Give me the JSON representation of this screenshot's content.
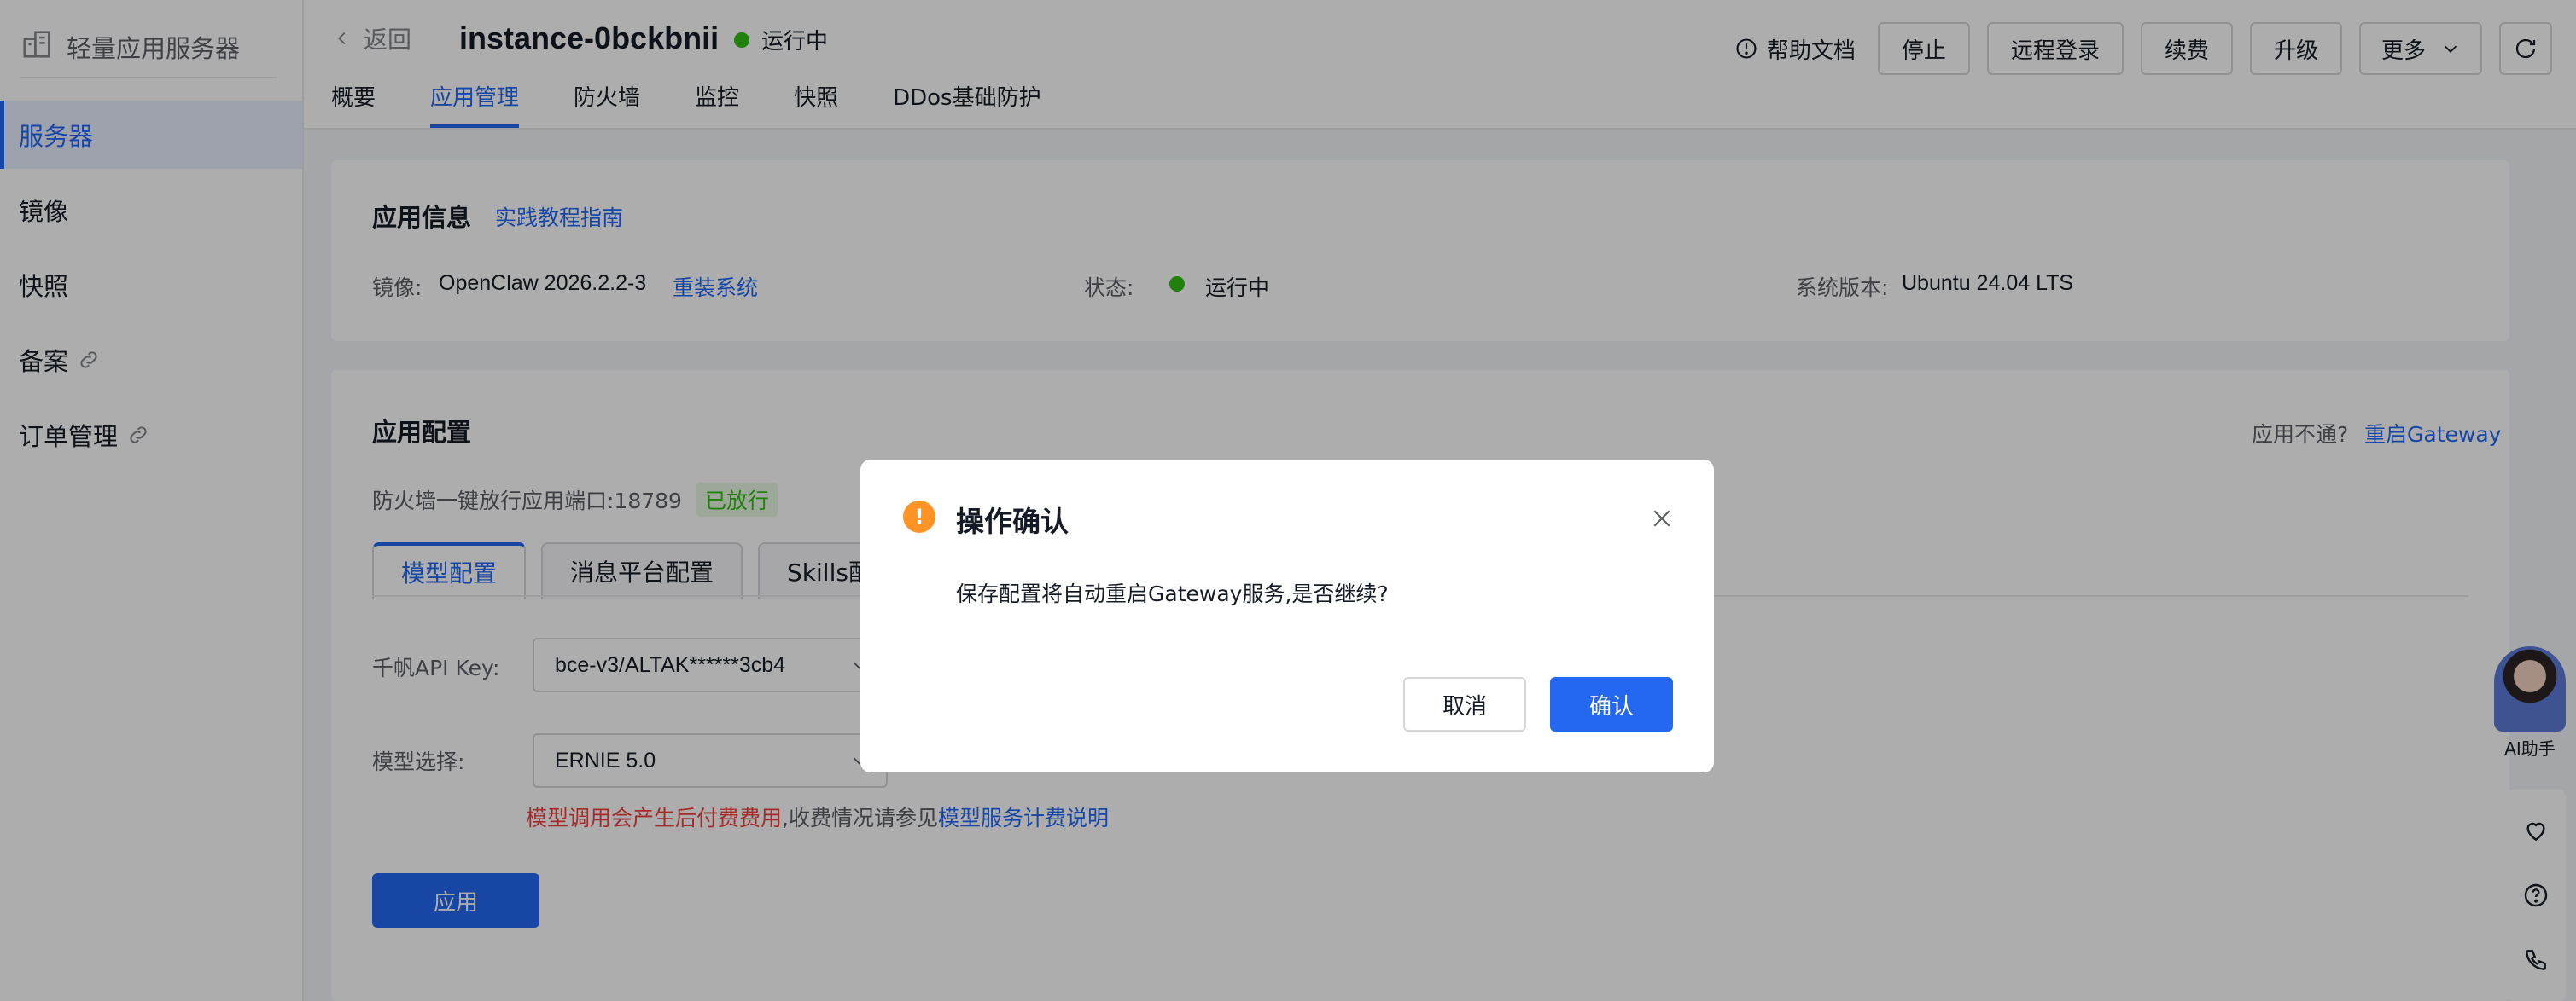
{
  "sidebar": {
    "title": "轻量应用服务器",
    "items": [
      {
        "label": "服务器",
        "active": true
      },
      {
        "label": "镜像"
      },
      {
        "label": "快照"
      },
      {
        "label": "备案",
        "external": true
      },
      {
        "label": "订单管理",
        "external": true
      }
    ]
  },
  "header": {
    "back": "返回",
    "instance": "instance-0bckbnii",
    "status": "运行中",
    "tabs": [
      "概要",
      "应用管理",
      "防火墙",
      "监控",
      "快照",
      "DDos基础防护"
    ],
    "active_tab": "应用管理",
    "help": "帮助文档",
    "actions": [
      "停止",
      "远程登录",
      "续费",
      "升级"
    ],
    "more": "更多"
  },
  "app_info": {
    "title": "应用信息",
    "guide_link": "实践教程指南",
    "image_label": "镜像:",
    "image_value": "OpenClaw 2026.2.2-3",
    "reinstall": "重装系统",
    "state_label": "状态:",
    "state_value": "运行中",
    "os_label": "系统版本:",
    "os_value": "Ubuntu 24.04 LTS"
  },
  "app_config": {
    "title": "应用配置",
    "unreachable": "应用不通?",
    "restart": "重启Gateway",
    "firewall_text": "防火墙一键放行应用端口:18789",
    "firewall_badge": "已放行",
    "tabs": [
      "模型配置",
      "消息平台配置",
      "Skills配"
    ],
    "api_key_label": "千帆API Key:",
    "api_key_value": "bce-v3/ALTAK******3cb4",
    "model_label": "模型选择:",
    "model_value": "ERNIE 5.0",
    "notice_warn": "模型调用会产生后付费费用",
    "notice_rest": ",收费情况请参见",
    "notice_link": "模型服务计费说明",
    "apply": "应用"
  },
  "assistant": {
    "label": "AI助手"
  },
  "modal": {
    "title": "操作确认",
    "icon": "!",
    "message": "保存配置将自动重启Gateway服务,是否继续?",
    "cancel": "取消",
    "confirm": "确认"
  },
  "colors": {
    "primary": "#2468f2",
    "success": "#30bf13",
    "warning": "#ff9326"
  }
}
